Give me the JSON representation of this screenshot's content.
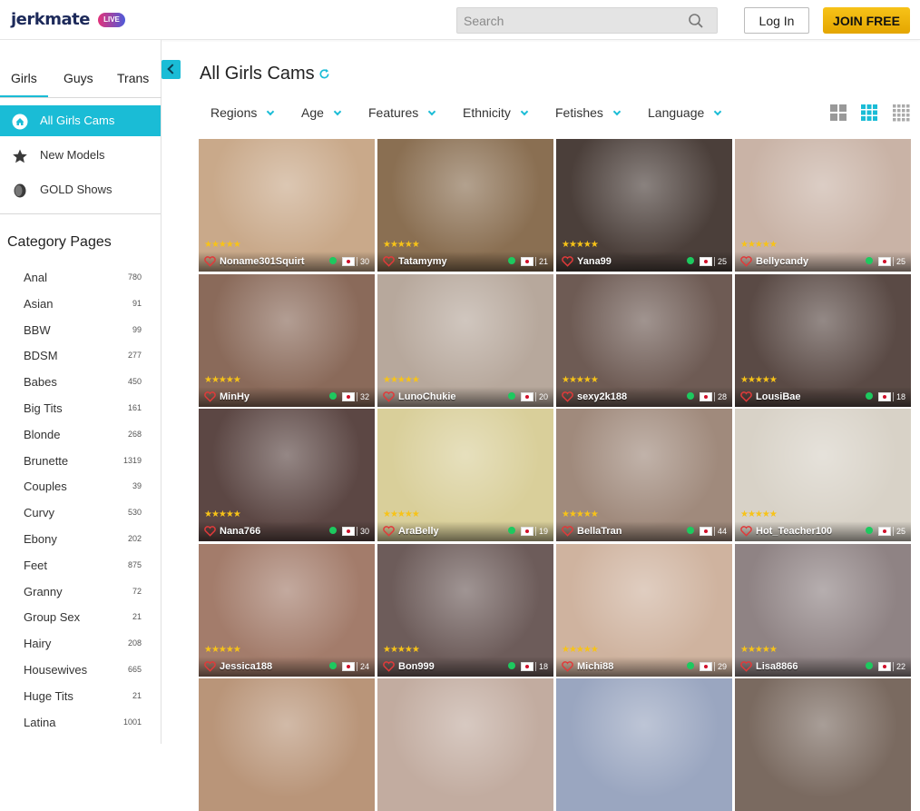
{
  "header": {
    "logo": "jerkmate",
    "logo_badge": "LIVE",
    "search_placeholder": "Search",
    "login_label": "Log In",
    "join_label": "JOIN FREE"
  },
  "sidebar": {
    "tabs": [
      "Girls",
      "Guys",
      "Trans"
    ],
    "nav": [
      {
        "label": "All Girls Cams",
        "icon": "home-icon"
      },
      {
        "label": "New Models",
        "icon": "star-icon"
      },
      {
        "label": "GOLD Shows",
        "icon": "gold-coin-icon"
      }
    ],
    "category_title": "Category Pages",
    "categories": [
      {
        "label": "Anal",
        "count": "780"
      },
      {
        "label": "Asian",
        "count": "91"
      },
      {
        "label": "BBW",
        "count": "99"
      },
      {
        "label": "BDSM",
        "count": "277"
      },
      {
        "label": "Babes",
        "count": "450"
      },
      {
        "label": "Big Tits",
        "count": "161"
      },
      {
        "label": "Blonde",
        "count": "268"
      },
      {
        "label": "Brunette",
        "count": "1319"
      },
      {
        "label": "Couples",
        "count": "39"
      },
      {
        "label": "Curvy",
        "count": "530"
      },
      {
        "label": "Ebony",
        "count": "202"
      },
      {
        "label": "Feet",
        "count": "875"
      },
      {
        "label": "Granny",
        "count": "72"
      },
      {
        "label": "Group Sex",
        "count": "21"
      },
      {
        "label": "Hairy",
        "count": "208"
      },
      {
        "label": "Housewives",
        "count": "665"
      },
      {
        "label": "Huge Tits",
        "count": "21"
      },
      {
        "label": "Latina",
        "count": "1001"
      }
    ]
  },
  "main": {
    "title": "All Girls Cams",
    "filters": [
      "Regions",
      "Age",
      "Features",
      "Ethnicity",
      "Fetishes",
      "Language"
    ],
    "cards": [
      {
        "name": "Noname301Squirt",
        "count": "30",
        "color": "#c9a98a"
      },
      {
        "name": "Tatamymy",
        "count": "21",
        "color": "#8a6f52"
      },
      {
        "name": "Yana99",
        "count": "25",
        "color": "#4b3f3a"
      },
      {
        "name": "Bellycandy",
        "count": "25",
        "color": "#c9b3a6"
      },
      {
        "name": "MinHy",
        "count": "32",
        "color": "#8a6a5a"
      },
      {
        "name": "LunoChukie",
        "count": "20",
        "color": "#b7a89c"
      },
      {
        "name": "sexy2k188",
        "count": "28",
        "color": "#6e5b54"
      },
      {
        "name": "LousiBae",
        "count": "18",
        "color": "#5a4a45"
      },
      {
        "name": "Nana766",
        "count": "30",
        "color": "#5c4744"
      },
      {
        "name": "AraBelly",
        "count": "19",
        "color": "#d9cf9a"
      },
      {
        "name": "BellaTran",
        "count": "44",
        "color": "#a08a7c"
      },
      {
        "name": "Hot_Teacher100",
        "count": "25",
        "color": "#d8d2c7"
      },
      {
        "name": "Jessica188",
        "count": "24",
        "color": "#a37c6b"
      },
      {
        "name": "Bon999",
        "count": "18",
        "color": "#6d5c5a"
      },
      {
        "name": "Michi88",
        "count": "29",
        "color": "#cfb39f"
      },
      {
        "name": "Lisa8866",
        "count": "22",
        "color": "#8f8384"
      },
      {
        "name": "",
        "count": "",
        "color": "#b99579"
      },
      {
        "name": "",
        "count": "",
        "color": "#c2aca0"
      },
      {
        "name": "",
        "count": "",
        "color": "#9aa6c0"
      },
      {
        "name": "",
        "count": "",
        "color": "#7a6a60"
      }
    ]
  },
  "colors": {
    "accent": "#1abcd6",
    "join": "#f7c318",
    "online": "#1dc95f"
  }
}
